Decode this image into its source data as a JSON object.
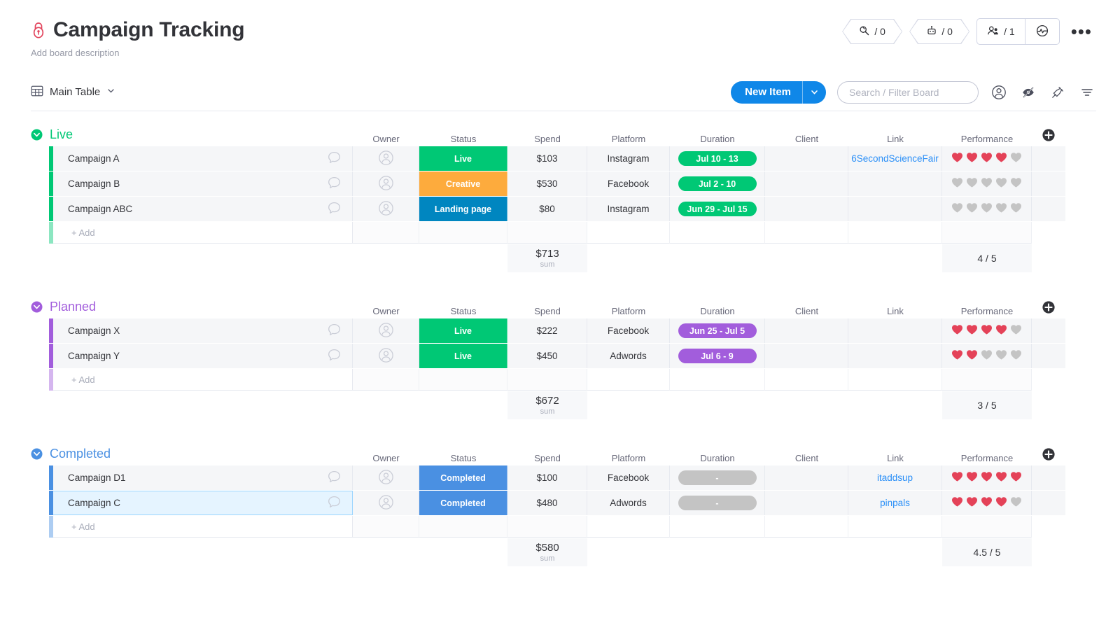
{
  "header": {
    "lock_icon": "lock-icon",
    "title": "Campaign Tracking",
    "description": "Add board description",
    "pills": [
      {
        "icon": "activity-search-icon",
        "value": "/ 0"
      },
      {
        "icon": "automation-robot-icon",
        "value": "/ 0"
      }
    ],
    "people": {
      "icon": "people-icon",
      "value": "/ 1"
    },
    "integrations_icon": "integrations-pulse-icon",
    "more_label": "•••"
  },
  "toolbar": {
    "view_icon": "table-view-icon",
    "view_label": "Main Table",
    "view_caret": "chevron-down-icon",
    "new_item_label": "New Item",
    "new_item_caret": "chevron-down-icon",
    "search_placeholder": "Search / Filter Board",
    "search_value": "",
    "icons": [
      "person-circle-icon",
      "hide-eye-icon",
      "pin-icon",
      "filter-icon"
    ]
  },
  "columns": [
    {
      "key": "name",
      "label": ""
    },
    {
      "key": "owner",
      "label": "Owner"
    },
    {
      "key": "status",
      "label": "Status"
    },
    {
      "key": "spend",
      "label": "Spend"
    },
    {
      "key": "platform",
      "label": "Platform"
    },
    {
      "key": "duration",
      "label": "Duration"
    },
    {
      "key": "client",
      "label": "Client"
    },
    {
      "key": "link",
      "label": "Link"
    },
    {
      "key": "performance",
      "label": "Performance"
    }
  ],
  "add_column_icon": "add-column-plus-icon",
  "add_item_label": "+ Add",
  "colors": {
    "green": "#00c875",
    "orange": "#fdab3d",
    "blue_status": "#0086c0",
    "blue_completed": "#4a90e2",
    "purple": "#a25ddc",
    "gray_pill": "#c4c4c4",
    "heart_filled": "#e44258",
    "heart_empty": "#c4c4c4",
    "link": "#2a8ff7",
    "accent": "#0f87e8"
  },
  "groups": [
    {
      "name": "Live",
      "color": "#00c875",
      "collapse_icon": "collapse-group-icon",
      "items": [
        {
          "name": "Campaign A",
          "selected": false,
          "status": {
            "label": "Live",
            "color": "#00c875"
          },
          "spend": "$103",
          "platform": "Instagram",
          "duration": {
            "label": "Jul 10 - 13",
            "color": "#00c875"
          },
          "client": "",
          "link": "6SecondScienceFair",
          "performance": {
            "filled": 4,
            "total": 5
          }
        },
        {
          "name": "Campaign B",
          "selected": false,
          "status": {
            "label": "Creative",
            "color": "#fdab3d"
          },
          "spend": "$530",
          "platform": "Facebook",
          "duration": {
            "label": "Jul 2 - 10",
            "color": "#00c875"
          },
          "client": "",
          "link": "",
          "performance": {
            "filled": 0,
            "total": 5
          }
        },
        {
          "name": "Campaign ABC",
          "selected": false,
          "status": {
            "label": "Landing page",
            "color": "#0086c0"
          },
          "spend": "$80",
          "platform": "Instagram",
          "duration": {
            "label": "Jun 29 - Jul 15",
            "color": "#00c875"
          },
          "client": "",
          "link": "",
          "performance": {
            "filled": 0,
            "total": 5
          }
        }
      ],
      "summary": {
        "spend_value": "$713",
        "spend_label": "sum",
        "performance_value": "4 / 5"
      }
    },
    {
      "name": "Planned",
      "color": "#a25ddc",
      "collapse_icon": "collapse-group-icon",
      "items": [
        {
          "name": "Campaign X",
          "selected": false,
          "status": {
            "label": "Live",
            "color": "#00c875"
          },
          "spend": "$222",
          "platform": "Facebook",
          "duration": {
            "label": "Jun 25 - Jul 5",
            "color": "#a25ddc"
          },
          "client": "",
          "link": "",
          "performance": {
            "filled": 4,
            "total": 5
          }
        },
        {
          "name": "Campaign Y",
          "selected": false,
          "status": {
            "label": "Live",
            "color": "#00c875"
          },
          "spend": "$450",
          "platform": "Adwords",
          "duration": {
            "label": "Jul 6 - 9",
            "color": "#a25ddc"
          },
          "client": "",
          "link": "",
          "performance": {
            "filled": 2,
            "total": 5
          }
        }
      ],
      "summary": {
        "spend_value": "$672",
        "spend_label": "sum",
        "performance_value": "3 / 5"
      }
    },
    {
      "name": "Completed",
      "color": "#4a90e2",
      "collapse_icon": "collapse-group-icon",
      "items": [
        {
          "name": "Campaign D1",
          "selected": false,
          "status": {
            "label": "Completed",
            "color": "#4a90e2"
          },
          "spend": "$100",
          "platform": "Facebook",
          "duration": {
            "label": "-",
            "color": "#c4c4c4"
          },
          "client": "",
          "link": "itaddsup",
          "performance": {
            "filled": 5,
            "total": 5
          }
        },
        {
          "name": "Campaign C",
          "selected": true,
          "status": {
            "label": "Completed",
            "color": "#4a90e2"
          },
          "spend": "$480",
          "platform": "Adwords",
          "duration": {
            "label": "-",
            "color": "#c4c4c4"
          },
          "client": "",
          "link": "pinpals",
          "performance": {
            "filled": 4,
            "total": 5
          }
        }
      ],
      "summary": {
        "spend_value": "$580",
        "spend_label": "sum",
        "performance_value": "4.5 / 5"
      }
    }
  ]
}
